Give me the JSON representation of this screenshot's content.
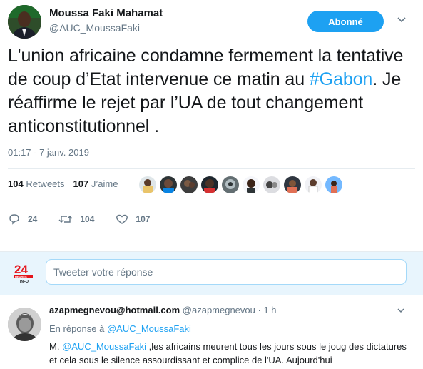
{
  "tweet": {
    "author_name": "Moussa Faki Mahamat",
    "author_handle": "@AUC_MoussaFaki",
    "follow_label": "Abonné",
    "text_before": "L'union africaine condamne fermement la tentative de coup d’Etat intervenue ce matin au ",
    "hashtag": "#Gabon",
    "text_after": ". Je réaffirme le rejet par l’UA de tout changement anticonstitutionnel .",
    "timestamp": "01:17 - 7 janv. 2019",
    "retweets_count": "104",
    "retweets_label": "Retweets",
    "likes_count": "107",
    "likes_label": "J’aime",
    "actions": {
      "reply_count": "24",
      "retweet_count": "104",
      "like_count": "107"
    },
    "colors": {
      "accent": "#1da1f2",
      "muted": "#657786"
    }
  },
  "reply_composer": {
    "placeholder": "Tweeter votre réponse",
    "avatar_logo_text": "24",
    "avatar_logo_subtext": "HEURES INFO"
  },
  "reply": {
    "author_email": "azapmegnevou@hotmail.com",
    "author_handle": "@azapmegnevou",
    "time": "· 1 h",
    "replying_to_prefix": "En réponse à",
    "replying_to_mention": "@AUC_MoussaFaki",
    "body_prefix": "M. ",
    "body_mention": "@AUC_MoussaFaki",
    "body_text": " ,les africains meurent tous les jours sous le joug des dictatures et cela sous le silence assourdissant et complice de l'UA. Aujourd'hui"
  }
}
